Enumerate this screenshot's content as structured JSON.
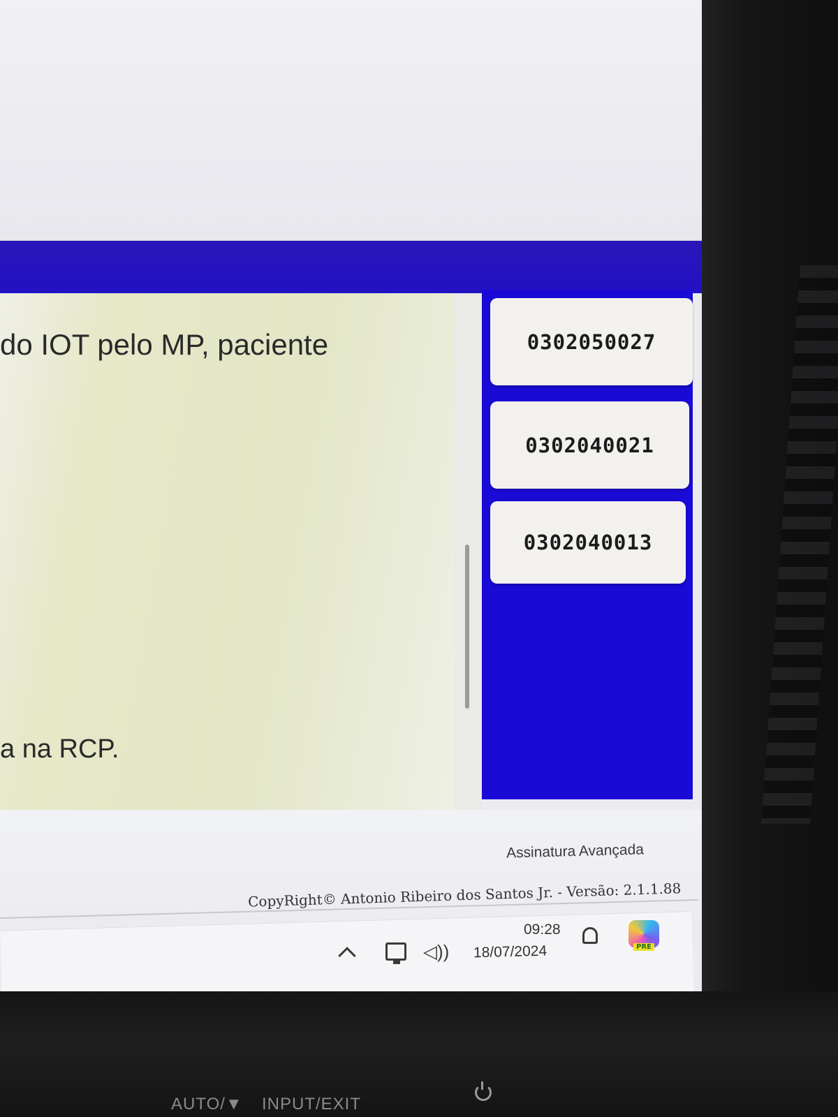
{
  "document": {
    "line1": "do IOT  pelo MP, paciente",
    "line2": "a na RCP."
  },
  "codes": [
    {
      "label": "0302050027"
    },
    {
      "label": "0302040021"
    },
    {
      "label": "0302040013"
    }
  ],
  "footer": {
    "signature": "Assinatura Avançada",
    "copyright": "CopyRight© Antonio Ribeiro dos Santos Jr. - Versão: 2.1.1.88"
  },
  "taskbar": {
    "time": "09:28",
    "date": "18/07/2024",
    "copilot_badge": "PRE",
    "speaker_glyph": "◁))"
  },
  "monitor": {
    "left_label": "AUTO/▼",
    "right_label": "INPUT/EXIT"
  },
  "colors": {
    "accent_blue": "#1a0ad6",
    "band_blue": "#2311c4"
  }
}
